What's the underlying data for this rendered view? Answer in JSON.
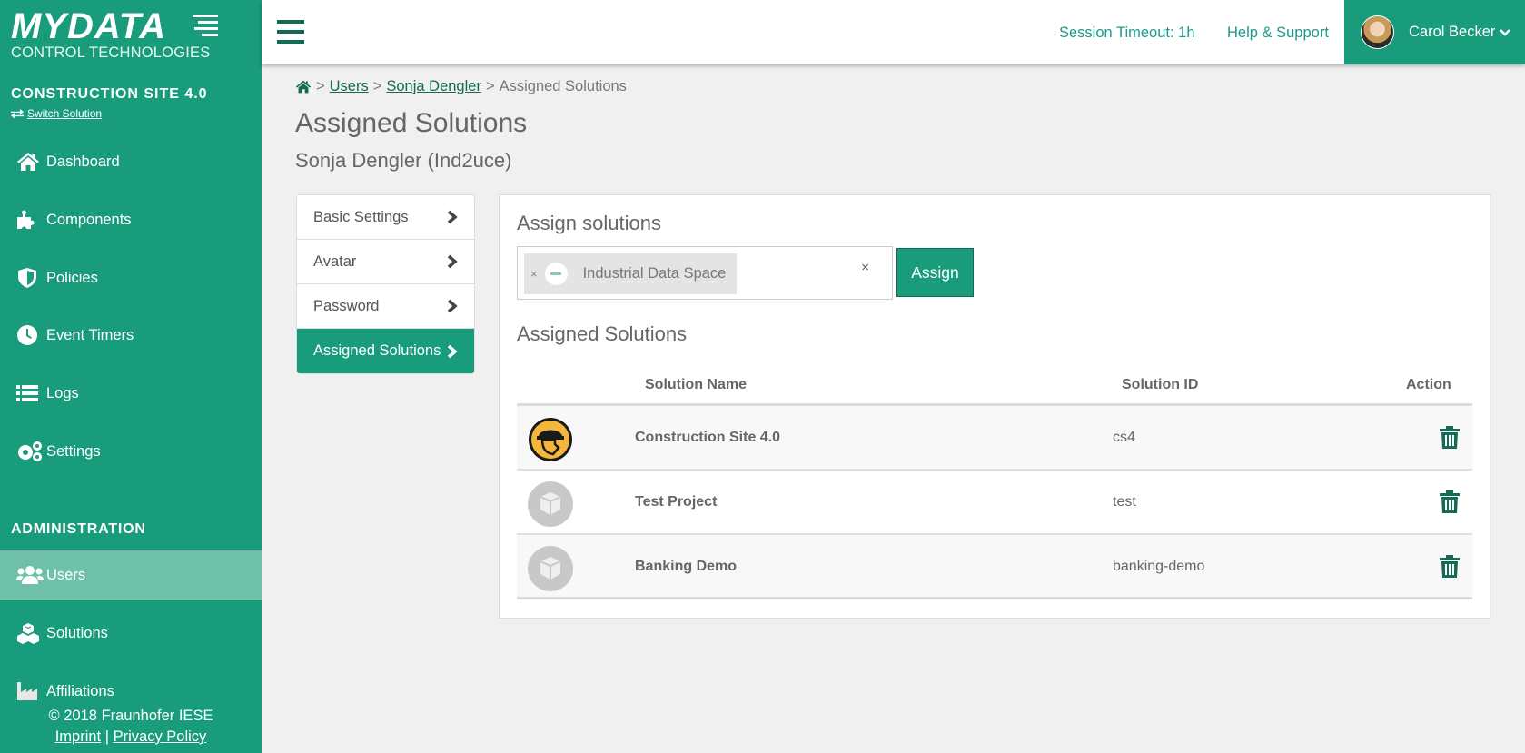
{
  "brand": {
    "logo_main": "MYDATA",
    "logo_sub": "CONTROL TECHNOLOGIES",
    "site_title": "CONSTRUCTION SITE 4.0",
    "switch_label": "Switch Solution"
  },
  "sidebar": {
    "items": [
      {
        "label": "Dashboard",
        "icon": "home-icon"
      },
      {
        "label": "Components",
        "icon": "puzzle-icon"
      },
      {
        "label": "Policies",
        "icon": "shield-icon"
      },
      {
        "label": "Event Timers",
        "icon": "clock-icon"
      },
      {
        "label": "Logs",
        "icon": "list-icon"
      },
      {
        "label": "Settings",
        "icon": "gears-icon"
      }
    ],
    "admin_title": "ADMINISTRATION",
    "admin_items": [
      {
        "label": "Users",
        "icon": "users-icon",
        "active": true
      },
      {
        "label": "Solutions",
        "icon": "cubes-icon"
      },
      {
        "label": "Affiliations",
        "icon": "industry-icon"
      }
    ],
    "footer": {
      "copyright": "© 2018 Fraunhofer IESE",
      "imprint": "Imprint",
      "separator": "|",
      "privacy": "Privacy Policy"
    }
  },
  "topbar": {
    "session_timeout": "Session Timeout: 1h",
    "help": "Help & Support",
    "user_name": "Carol Becker"
  },
  "breadcrumb": {
    "sep": ">",
    "users": "Users",
    "person": "Sonja Dengler",
    "current": "Assigned Solutions"
  },
  "page": {
    "title": "Assigned Solutions",
    "subtitle": "Sonja Dengler (Ind2uce)"
  },
  "side_menu": {
    "items": [
      {
        "label": "Basic Settings"
      },
      {
        "label": "Avatar"
      },
      {
        "label": "Password"
      },
      {
        "label": "Assigned Solutions",
        "active": true
      }
    ]
  },
  "assign": {
    "heading": "Assign solutions",
    "selected_tag": "Industrial Data Space",
    "remove_tag": "×",
    "clear": "×",
    "button": "Assign"
  },
  "assigned": {
    "heading": "Assigned Solutions",
    "columns": [
      "Solution Name",
      "Solution ID",
      "Action"
    ],
    "rows": [
      {
        "name": "Construction Site 4.0",
        "id": "cs4",
        "icon": "construction-worker-logo"
      },
      {
        "name": "Test Project",
        "id": "test",
        "icon": "cube-placeholder-icon"
      },
      {
        "name": "Banking Demo",
        "id": "banking-demo",
        "icon": "cube-placeholder-icon"
      }
    ]
  },
  "colors": {
    "primary": "#189c7b",
    "dark_accent": "#146a55",
    "active_nav": "#6fc0a8",
    "link_teal": "#1a9a88",
    "background": "#f0f0f0"
  }
}
